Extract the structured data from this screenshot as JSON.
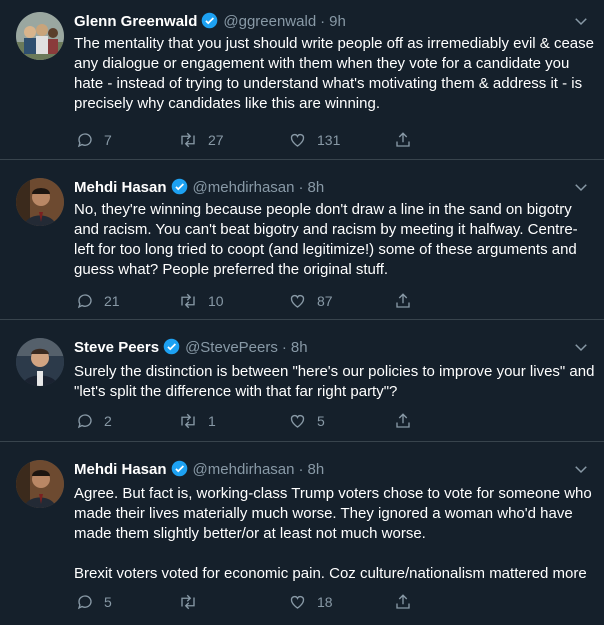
{
  "colors": {
    "background": "#15202b",
    "text": "#ffffff",
    "muted": "#8899a6",
    "verified": "#1da1f2",
    "divider": "#38444d"
  },
  "tweets": [
    {
      "name": "Glenn Greenwald",
      "handle": "@ggreenwald",
      "time": "9h",
      "text": "The mentality that you just should write people off as irremediably evil & cease any dialogue or engagement with them when they vote for a candidate you hate - instead of trying to understand what's motivating them & address it - is precisely why candidates like this are winning.",
      "replies": "7",
      "retweets": "27",
      "likes": "131"
    },
    {
      "name": "Mehdi Hasan",
      "handle": "@mehdirhasan",
      "time": "8h",
      "text": "No, they're winning because people don't draw a line in the sand on bigotry and racism. You can't beat bigotry and racism by meeting it halfway. Centre-left for too long tried to coopt (and legitimize!) some of these arguments and guess what? People preferred the original stuff.",
      "replies": "21",
      "retweets": "10",
      "likes": "87"
    },
    {
      "name": "Steve Peers",
      "handle": "@StevePeers",
      "time": "8h",
      "text": "Surely the distinction is between \"here's our policies to improve your lives\" and \"let's split the difference with that far right party\"?",
      "replies": "2",
      "retweets": "1",
      "likes": "5"
    },
    {
      "name": "Mehdi Hasan",
      "handle": "@mehdirhasan",
      "time": "8h",
      "text": "Agree. But fact is, working-class Trump voters chose to vote for someone who made their lives materially much worse. They ignored a woman who'd have made them slightly better/or at least not much worse.\n\nBrexit voters voted for economic pain. Coz culture/nationalism mattered more",
      "replies": "5",
      "retweets": "",
      "likes": "18"
    }
  ]
}
